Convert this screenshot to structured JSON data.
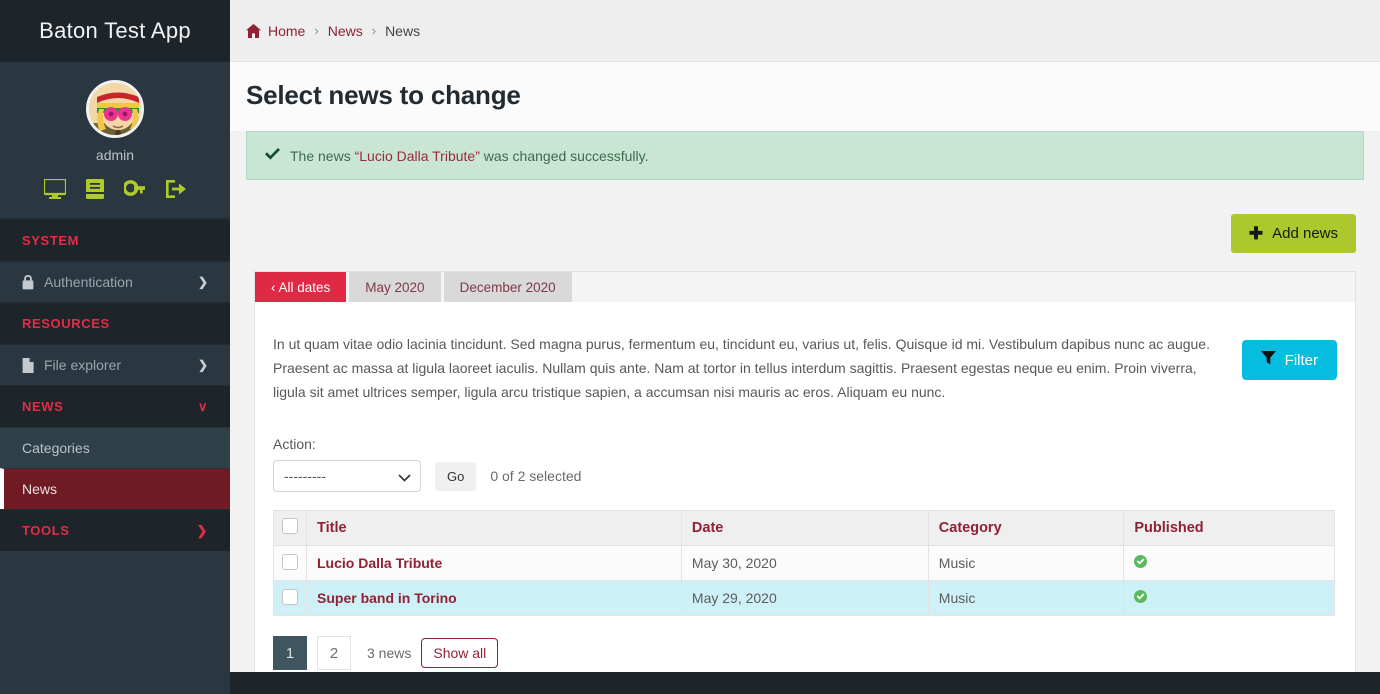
{
  "sidebar": {
    "brand": "Baton Test App",
    "user": {
      "name": "admin",
      "avatar_icon": "user-avatar"
    },
    "quick_icons": [
      {
        "name": "monitor-icon",
        "label": "Site"
      },
      {
        "name": "book-icon",
        "label": "Docs"
      },
      {
        "name": "key-icon",
        "label": "Change password"
      },
      {
        "name": "logout-icon",
        "label": "Log out"
      }
    ],
    "nav": [
      {
        "type": "section",
        "label": "SYSTEM",
        "chevron": ""
      },
      {
        "type": "item",
        "label": "Authentication",
        "icon": "lock-icon",
        "chevron": "❯"
      },
      {
        "type": "section",
        "label": "RESOURCES",
        "chevron": ""
      },
      {
        "type": "item",
        "label": "File explorer",
        "icon": "file-icon",
        "chevron": "❯"
      },
      {
        "type": "section",
        "label": "NEWS",
        "chevron": "∨"
      },
      {
        "type": "sub",
        "label": "Categories",
        "active": false
      },
      {
        "type": "sub",
        "label": "News",
        "active": true
      },
      {
        "type": "section",
        "label": "TOOLS",
        "chevron": "❯"
      }
    ]
  },
  "breadcrumb": {
    "home_icon": "home-icon",
    "items": [
      "Home",
      "News"
    ],
    "current": "News",
    "separator": "›"
  },
  "header": {
    "title": "Select news to change"
  },
  "alert": {
    "check_icon": "check-icon",
    "prefix": "The news ",
    "quoted": "“Lucio Dalla Tribute”",
    "suffix": " was changed successfully."
  },
  "toolbar": {
    "add_label": "Add news",
    "add_icon": "plus-icon",
    "add_color": "#acc82c"
  },
  "date_tabs": [
    {
      "label": "‹ All dates",
      "active": true
    },
    {
      "label": "May 2020",
      "active": false
    },
    {
      "label": "December 2020",
      "active": false
    }
  ],
  "description": "In ut quam vitae odio lacinia tincidunt. Sed magna purus, fermentum eu, tincidunt eu, varius ut, felis. Quisque id mi. Vestibulum dapibus nunc ac augue. Praesent ac massa at ligula laoreet iaculis. Nullam quis ante. Nam at tortor in tellus interdum sagittis. Praesent egestas neque eu enim. Proin viverra, ligula sit amet ultrices semper, ligula arcu tristique sapien, a accumsan nisi mauris ac eros. Aliquam eu nunc.",
  "filter": {
    "label": "Filter",
    "icon": "funnel-icon",
    "color": "#06bde0"
  },
  "action": {
    "label": "Action:",
    "selected": "---------",
    "options": [
      "---------"
    ],
    "go_label": "Go",
    "selected_count": "0 of 2 selected"
  },
  "table": {
    "columns": [
      "Title",
      "Date",
      "Category",
      "Published"
    ],
    "select_all_name": "select-all-checkbox",
    "rows": [
      {
        "title": "Lucio Dalla Tribute",
        "date": "May 30, 2020",
        "category": "Music",
        "published": true,
        "published_icon": "check-circle-icon"
      },
      {
        "title": "Super band in Torino",
        "date": "May 29, 2020",
        "category": "Music",
        "published": true,
        "published_icon": "check-circle-icon"
      }
    ]
  },
  "pagination": {
    "pages": [
      "1",
      "2"
    ],
    "current": "1",
    "count_label": "3 news",
    "show_all_label": "Show all"
  },
  "colors": {
    "sidebar_bg": "#2a3740",
    "sidebar_dark": "#1d252b",
    "accent_red": "#e32c46",
    "accent_dark_red": "#8f2134",
    "accent_green": "#acc82c",
    "accent_cyan": "#06bde0",
    "row_highlight": "#cdf1f7",
    "alert_bg": "#c9e5d3"
  }
}
